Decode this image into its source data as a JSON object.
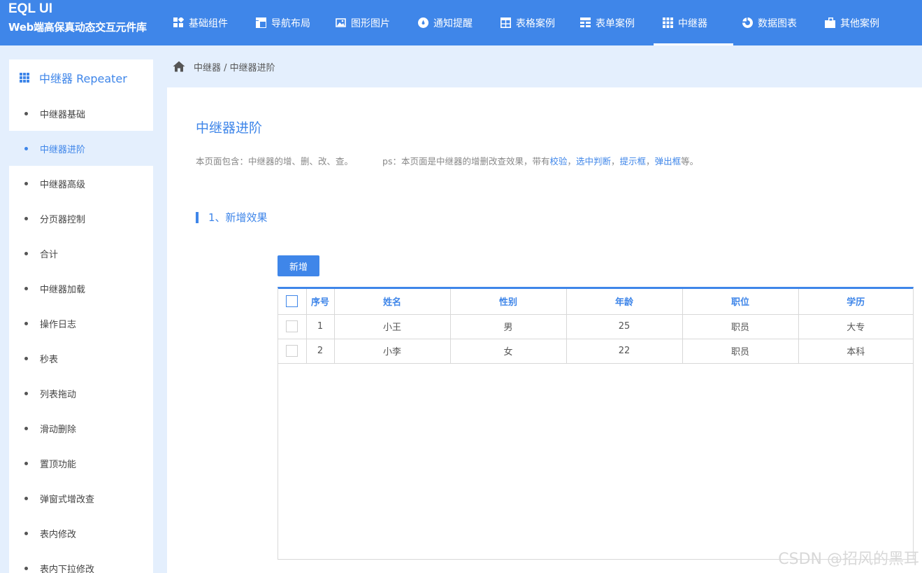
{
  "brand": {
    "title": "EQL UI",
    "subtitle": "Web端高保真动态交互元件库"
  },
  "nav": [
    {
      "label": "基础组件",
      "icon": "components-icon"
    },
    {
      "label": "导航布局",
      "icon": "layout-icon"
    },
    {
      "label": "图形图片",
      "icon": "image-icon"
    },
    {
      "label": "通知提醒",
      "icon": "bell-icon"
    },
    {
      "label": "表格案例",
      "icon": "table-icon"
    },
    {
      "label": "表单案例",
      "icon": "form-icon"
    },
    {
      "label": "中继器",
      "icon": "repeater-icon",
      "active": true
    },
    {
      "label": "数据图表",
      "icon": "chart-icon"
    },
    {
      "label": "其他案例",
      "icon": "folder-icon"
    }
  ],
  "sidebar": {
    "title": "中继器 Repeater",
    "items": [
      {
        "label": "中继器基础"
      },
      {
        "label": "中继器进阶",
        "active": true
      },
      {
        "label": "中继器高级"
      },
      {
        "label": "分页器控制"
      },
      {
        "label": "合计"
      },
      {
        "label": "中继器加载"
      },
      {
        "label": "操作日志"
      },
      {
        "label": "秒表"
      },
      {
        "label": "列表拖动"
      },
      {
        "label": "滑动删除"
      },
      {
        "label": "置顶功能"
      },
      {
        "label": "弹窗式增改查"
      },
      {
        "label": "表内修改"
      },
      {
        "label": "表内下拉修改"
      }
    ]
  },
  "breadcrumb": "中继器 / 中继器进阶",
  "page": {
    "title": "中继器进阶",
    "desc_prefix": "本页面包含：中继器的增、删、改、查。",
    "desc_ps": "ps：本页面是中继器的增删改查效果，带有",
    "link1": "校验",
    "link2": "选中判断",
    "link3": "提示框",
    "link4": "弹出框",
    "desc_suffix": "等。",
    "section": "1、新增效果",
    "add_button": "新增"
  },
  "table": {
    "headers": [
      "序号",
      "姓名",
      "性别",
      "年龄",
      "职位",
      "学历"
    ],
    "rows": [
      [
        "1",
        "小王",
        "男",
        "25",
        "职员",
        "大专"
      ],
      [
        "2",
        "小李",
        "女",
        "22",
        "职员",
        "本科"
      ]
    ]
  },
  "watermark": "CSDN @招风的黑耳",
  "colors": {
    "accent": "#3f86e9",
    "background": "#e4effd"
  }
}
